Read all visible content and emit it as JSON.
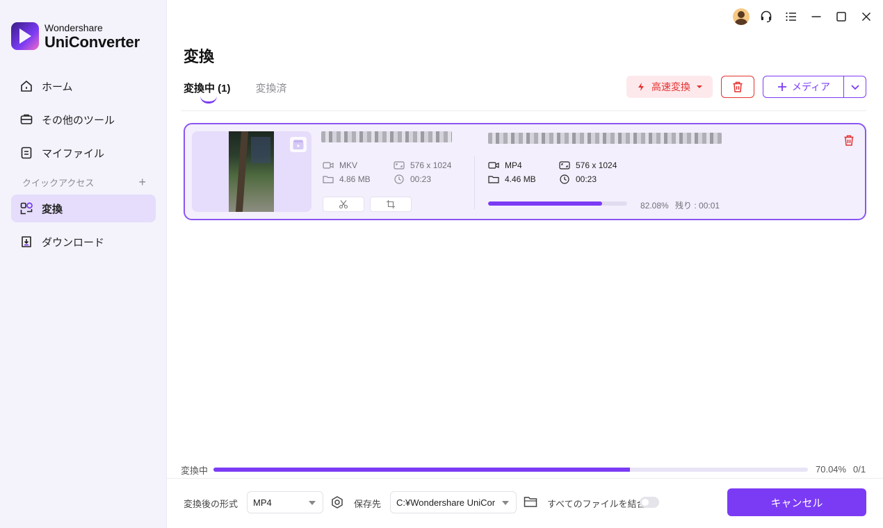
{
  "app": {
    "brand": "Wondershare",
    "product": "UniConverter"
  },
  "sidebar": {
    "items": [
      {
        "label": "ホーム",
        "icon": "home-icon"
      },
      {
        "label": "その他のツール",
        "icon": "toolbox-icon"
      },
      {
        "label": "マイファイル",
        "icon": "file-icon"
      }
    ],
    "section_label": "クイックアクセス",
    "quick_items": [
      {
        "label": "変換",
        "icon": "convert-icon",
        "active": true
      },
      {
        "label": "ダウンロード",
        "icon": "download-icon"
      }
    ]
  },
  "page": {
    "title": "変換",
    "tabs": [
      {
        "label": "変換中 (1)",
        "active": true
      },
      {
        "label": "変換済",
        "active": false
      }
    ]
  },
  "toolbar": {
    "fast_convert_label": "高速変換",
    "add_media_label": "メディア"
  },
  "task": {
    "source": {
      "format": "MKV",
      "size": "4.86 MB",
      "resolution": "576 x 1024",
      "duration": "00:23"
    },
    "output": {
      "format": "MP4",
      "size": "4.46 MB",
      "resolution": "576 x 1024",
      "duration": "00:23"
    },
    "progress": 0.8208,
    "progress_text": "82.08%",
    "remaining_text": "残り : 00:01"
  },
  "overall": {
    "label": "変換中",
    "progress": 0.7004,
    "percent_text": "70.04%",
    "count_text": "0/1"
  },
  "footer": {
    "format_label": "変換後の形式",
    "format_value": "MP4",
    "save_label": "保存先",
    "save_path": "C:¥Wondershare UniCor",
    "merge_label": "すべてのファイルを結合",
    "merge_enabled": false,
    "cancel_label": "キャンセル"
  },
  "colors": {
    "accent": "#7b3bf4",
    "danger": "#e4312f",
    "sidebar_bg": "#f4f2fb"
  }
}
